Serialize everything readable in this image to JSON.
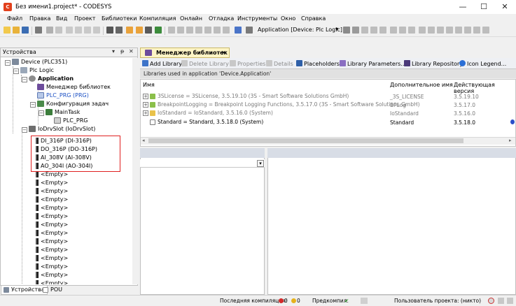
{
  "window": {
    "title": "Без имени1.project* - CODESYS",
    "minimize": "—",
    "maximize": "☐",
    "close": "✕"
  },
  "colors": {
    "accent": "#f5a623",
    "highlight": "#e02020",
    "tab_active": "#fdf4c5"
  },
  "menu": [
    "Файл",
    "Правка",
    "Вид",
    "Проект",
    "Библиотеки",
    "Компиляция",
    "Онлайн",
    "Отладка",
    "Инструменты",
    "Окно",
    "Справка"
  ],
  "toolbar": {
    "active_application": "Application [Device: Plc Logic]"
  },
  "left_panel": {
    "title": "Устройства",
    "controls": [
      "▾",
      "ᵽ",
      "✕"
    ],
    "tree": [
      {
        "label": "Device (PLC351)",
        "icon": "device-icon"
      },
      {
        "label": "Plc Logic",
        "icon": "plc-icon"
      },
      {
        "label": "Application",
        "icon": "gear-icon",
        "bold": true
      },
      {
        "label": "Менеджер библиотек",
        "icon": "library-icon"
      },
      {
        "label": "PLC_PRG (PRG)",
        "icon": "program-icon",
        "link": true
      },
      {
        "label": "Конфигурация задач",
        "icon": "task-config-icon"
      },
      {
        "label": "MainTask",
        "icon": "task-icon"
      },
      {
        "label": "PLC_PRG",
        "icon": "program-icon"
      },
      {
        "label": "IoDrvSlot (IoDrvSlot)",
        "icon": "slot-icon"
      },
      {
        "label": "DI_316P (DI-316P)",
        "icon": "module-icon"
      },
      {
        "label": "DO_316P (DO-316P)",
        "icon": "module-icon"
      },
      {
        "label": "AI_308V (AI-308V)",
        "icon": "module-icon"
      },
      {
        "label": "AO_304I (AO-304I)",
        "icon": "module-icon"
      }
    ],
    "empty_label": "<Empty>",
    "empty_count": 14,
    "tabs": [
      {
        "label": "Устройства",
        "icon": "devices-icon"
      },
      {
        "label": "POU",
        "icon": "pou-icon"
      }
    ]
  },
  "editor": {
    "tab": "Менеджер библиотек",
    "actions": [
      {
        "label": "Add Library",
        "enabled": true
      },
      {
        "label": "Delete Library",
        "enabled": false
      },
      {
        "label": "Properties",
        "enabled": false
      },
      {
        "label": "Details",
        "enabled": false
      },
      {
        "label": "Placeholders",
        "enabled": true
      },
      {
        "label": "Library Parameters...",
        "enabled": true
      },
      {
        "label": "Library Repository",
        "enabled": true
      },
      {
        "label": "Icon Legend...",
        "enabled": true
      }
    ],
    "info": "Libraries used in application 'Device.Application'",
    "columns": [
      "Имя",
      "Дополнительное имя",
      "Действующая версия"
    ],
    "rows": [
      {
        "name": "3SLicense = 3SLicense, 3.5.19.10 (3S - Smart Software Solutions GmbH)",
        "alt": "_3S_LICENSE",
        "version": "3.5.19.10",
        "grey": true
      },
      {
        "name": "BreakpointLogging = Breakpoint Logging Functions, 3.5.17.0 (3S - Smart Software Solutions GmbH)",
        "alt": "BPLog",
        "version": "3.5.17.0",
        "grey": true
      },
      {
        "name": "IoStandard = IoStandard, 3.5.16.0 (System)",
        "alt": "IoStandard",
        "version": "3.5.16.0",
        "grey": true
      },
      {
        "name": "Standard = Standard, 3.5.18.0 (System)",
        "alt": "Standard",
        "version": "3.5.18.0",
        "grey": false
      }
    ]
  },
  "status": {
    "last_compile_label": "Последняя компиляция:",
    "errors": "0",
    "warnings": "0",
    "precompile_label": "Предкомпил.",
    "precompile_mark": "✔",
    "user_label": "Пользователь проекта: (никто)"
  }
}
